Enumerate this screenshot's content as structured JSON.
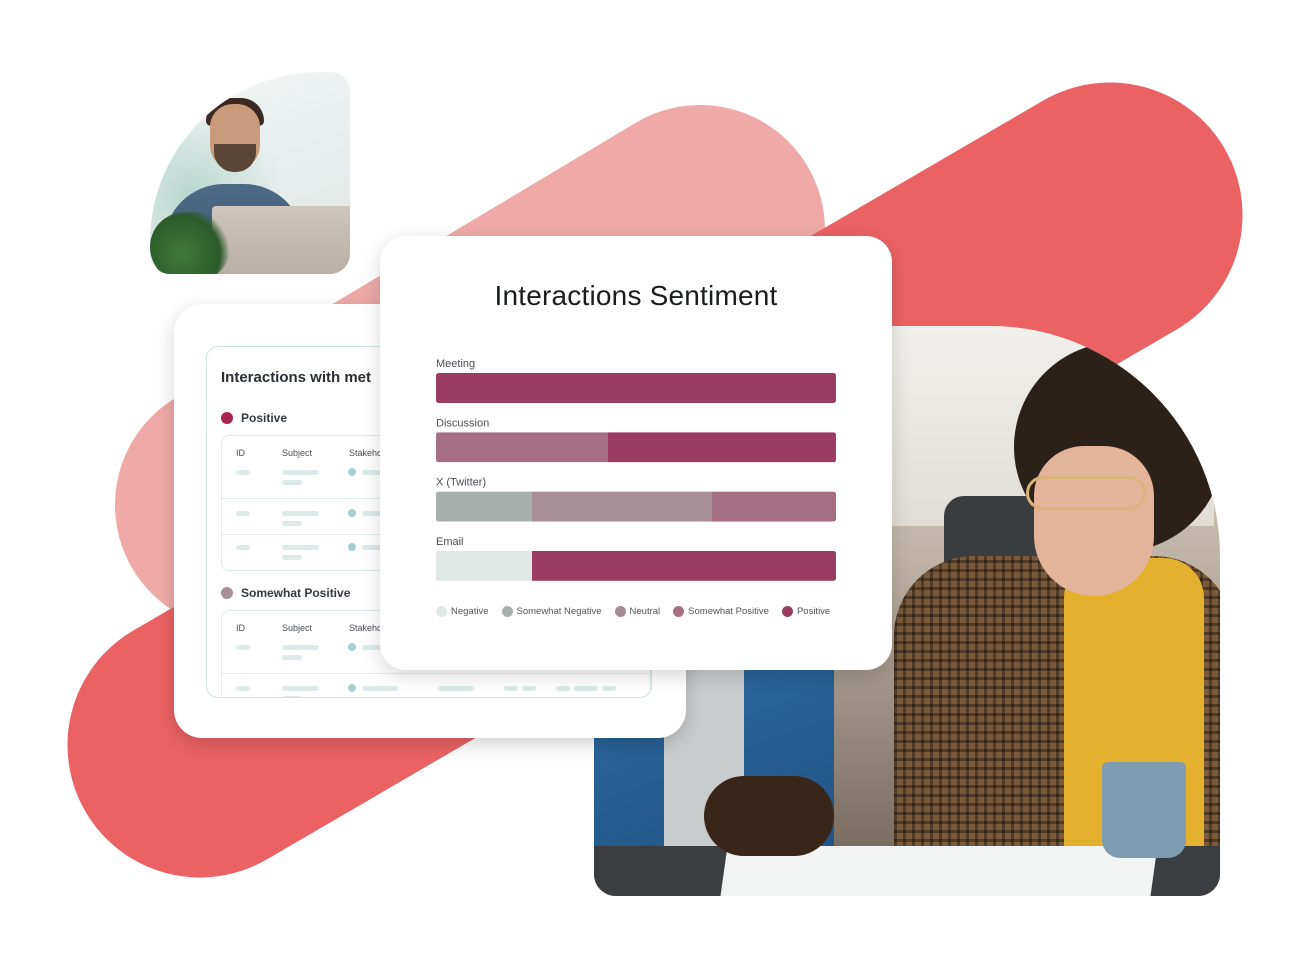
{
  "background": {
    "blob_colors": {
      "light": "#efaaa7",
      "dark": "#eb6264"
    }
  },
  "photos": {
    "top_left": "man-working-on-laptop-photo",
    "right": "colleagues-reviewing-charts-photo"
  },
  "back_card": {
    "title": "Interactions with met",
    "groups": [
      {
        "label": "Positive",
        "dot_color": "#a8234f",
        "columns": [
          "ID",
          "Subject",
          "Stakeho"
        ],
        "row_count": 3
      },
      {
        "label": "Somewhat Positive",
        "dot_color": "#a98e98",
        "columns": [
          "ID",
          "Subject",
          "Stakeho"
        ],
        "row_count": 2
      }
    ]
  },
  "front_card": {
    "title": "Interactions Sentiment"
  },
  "chart_data": {
    "type": "bar",
    "orientation": "horizontal",
    "stacked": true,
    "normalized_percent": true,
    "title": "Interactions Sentiment",
    "xlabel": "",
    "ylabel": "",
    "xlim": [
      0,
      100
    ],
    "grid": false,
    "legend_position": "bottom",
    "categories": [
      "Meeting",
      "Discussion",
      "X (Twitter)",
      "Email"
    ],
    "series": [
      {
        "name": "Negative",
        "color": "#dfe8e5",
        "values": [
          0,
          0,
          0,
          24
        ]
      },
      {
        "name": "Somewhat Negative",
        "color": "#a6afac",
        "values": [
          0,
          0,
          24,
          0
        ]
      },
      {
        "name": "Neutral",
        "color": "#a68d96",
        "values": [
          0,
          0,
          45,
          0
        ]
      },
      {
        "name": "Somewhat Positive",
        "color": "#a66e83",
        "values": [
          0,
          43,
          31,
          0
        ]
      },
      {
        "name": "Positive",
        "color": "#9b3d62",
        "values": [
          100,
          57,
          0,
          76
        ]
      }
    ]
  }
}
